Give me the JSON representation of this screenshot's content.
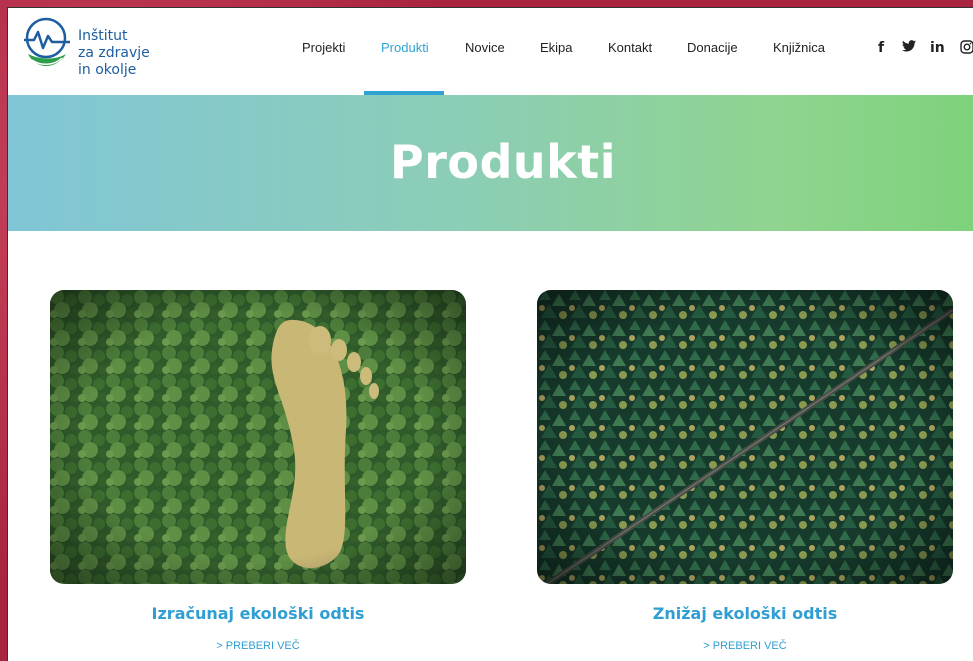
{
  "logo": {
    "lines": [
      "Inštitut",
      "za zdravje",
      "in okolje"
    ],
    "icon": "heartbeat-leaf-icon"
  },
  "nav": {
    "items": [
      "Projekti",
      "Produkti",
      "Novice",
      "Ekipa",
      "Kontakt",
      "Donacije",
      "Knjižnica"
    ],
    "active": "Produkti"
  },
  "social": {
    "icons": [
      "facebook-icon",
      "twitter-icon",
      "linkedin-icon",
      "instagram-icon"
    ],
    "glyphs": [
      "f",
      "🐦",
      "in",
      "◎"
    ]
  },
  "hero": {
    "title": "Produkti"
  },
  "cards": [
    {
      "title": "Izračunaj ekološki odtis",
      "link": "> PREBERI VEČ",
      "image": "footprint-forest-image"
    },
    {
      "title": "Znižaj ekološki odtis",
      "link": "> PREBERI VEČ",
      "image": "forest-road-image"
    }
  ],
  "colors": {
    "accent": "#2fa2d1",
    "logo_blue": "#1d5ea0",
    "logo_green": "#2e9e4a",
    "hero_start": "#80c6d6",
    "hero_end": "#7ed27b"
  }
}
